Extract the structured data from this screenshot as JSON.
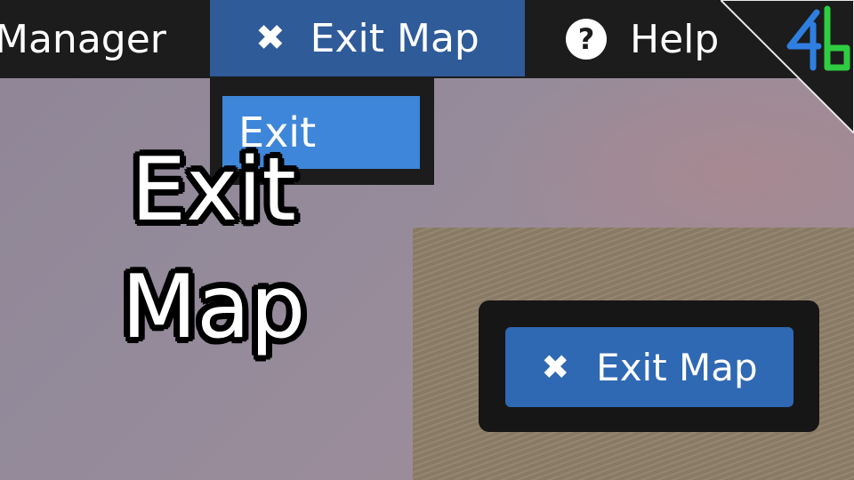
{
  "menubar": {
    "manager_label": "Manager",
    "exit_map_label": "Exit Map",
    "exit_map_icon": "close-icon",
    "help_label": "Help",
    "help_icon": "question-circle-icon",
    "background_color": "#1c1c1c",
    "active_color": "#2f5b99"
  },
  "dropdown": {
    "items": [
      {
        "label": "Exit"
      }
    ],
    "highlight_color": "#3e86d9"
  },
  "caption": {
    "line1": "Exit",
    "line2": "Map"
  },
  "panel": {
    "button_label": "Exit Map",
    "button_icon": "close-icon",
    "button_color": "#2f68b3"
  },
  "logo": {
    "icon": "app-logo-icon",
    "colors": [
      "#2f7fe0",
      "#2ecc40"
    ]
  }
}
